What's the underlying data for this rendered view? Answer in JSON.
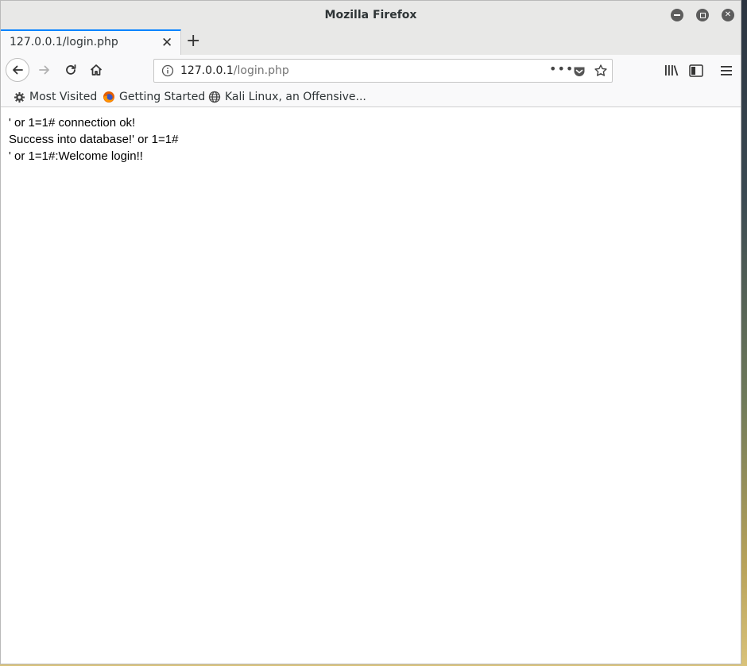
{
  "window": {
    "title": "Mozilla Firefox"
  },
  "tabs": [
    {
      "title": "127.0.0.1/login.php"
    }
  ],
  "urlbar": {
    "host": "127.0.0.1",
    "path": "/login.php"
  },
  "bookmarks": [
    {
      "label": "Most Visited",
      "icon": "gear-icon"
    },
    {
      "label": "Getting Started",
      "icon": "firefox-icon"
    },
    {
      "label": "Kali Linux, an Offensive...",
      "icon": "globe-icon"
    }
  ],
  "page": {
    "lines": [
      "' or 1=1# connection ok!",
      "Success into database!' or 1=1#",
      "' or 1=1#:Welcome login!!"
    ]
  }
}
